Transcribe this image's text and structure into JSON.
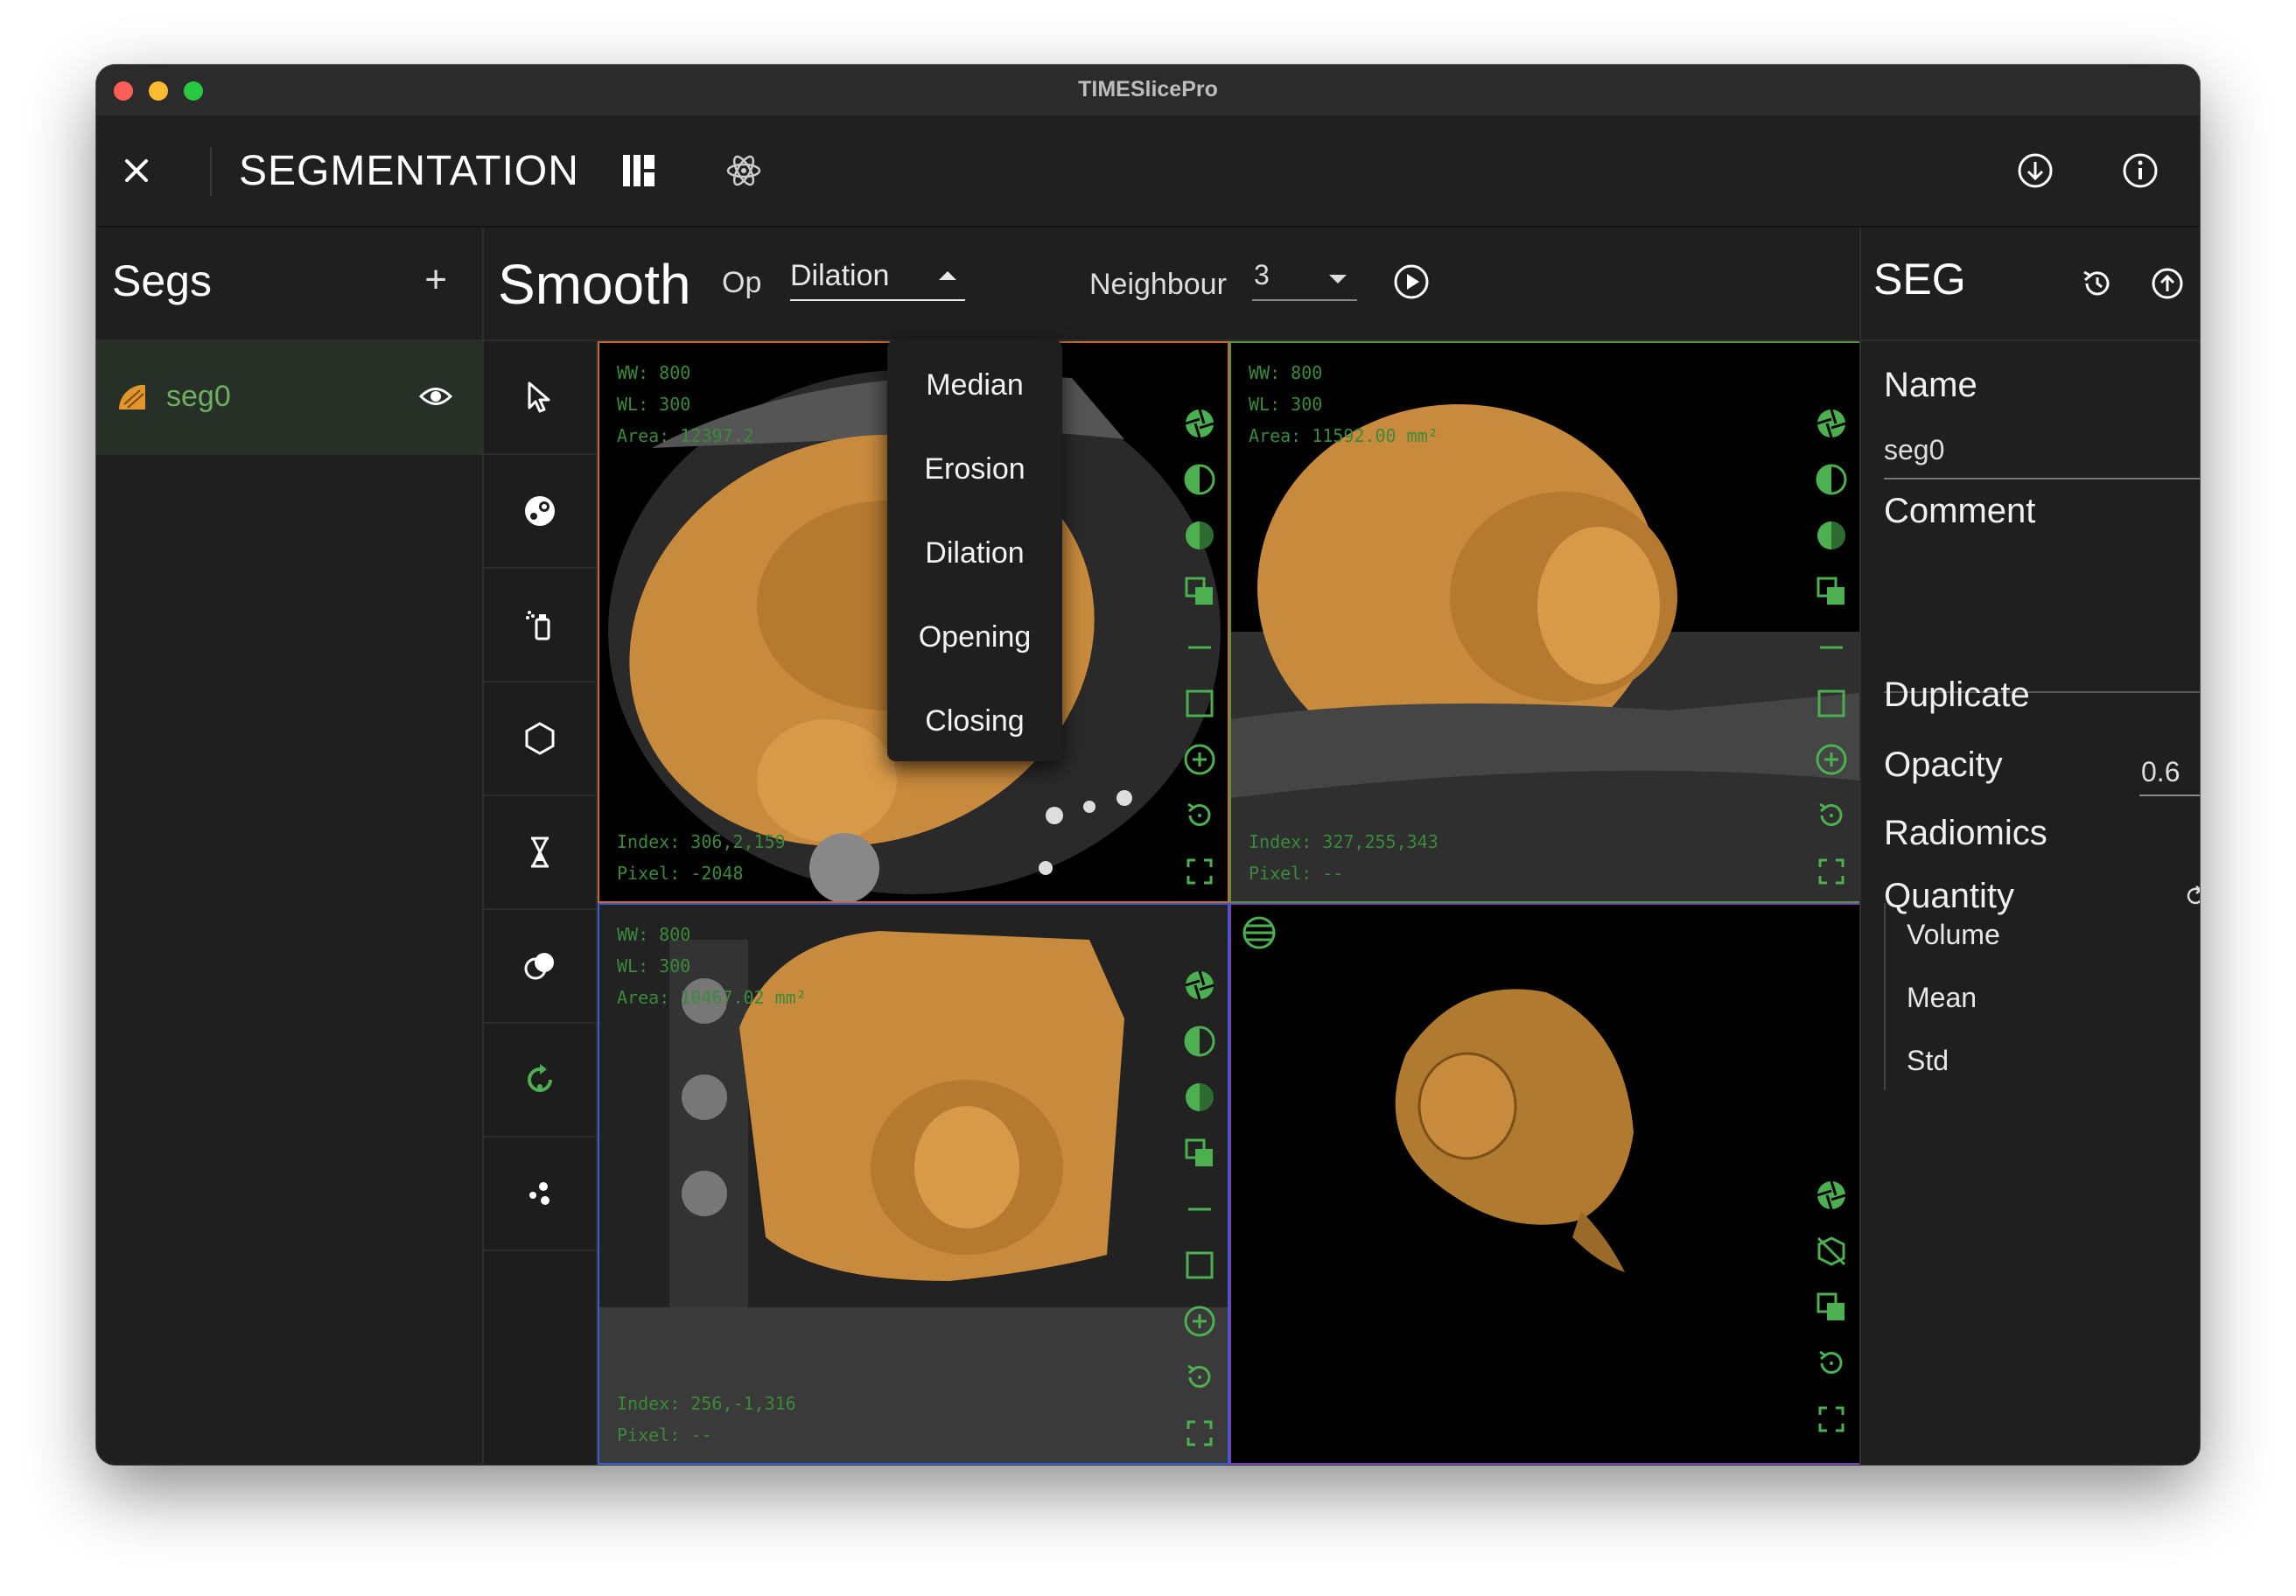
{
  "window": {
    "title": "TIMESlicePro"
  },
  "appbar": {
    "title": "SEGMENTATION"
  },
  "segs": {
    "title": "Segs",
    "add_label": "+",
    "items": [
      {
        "name": "seg0",
        "color": "#e0962c"
      }
    ]
  },
  "smooth": {
    "title": "Smooth",
    "op_label": "Op",
    "op_value": "Dilation",
    "neighbour_label": "Neighbour",
    "neighbour_value": "3",
    "op_options": [
      "Median",
      "Erosion",
      "Dilation",
      "Opening",
      "Closing"
    ]
  },
  "viewports": [
    {
      "ww": "WW: 800",
      "wl": "WL: 300",
      "area": "Area: 12397.2",
      "index": "Index: 306,2,159",
      "pixel": "Pixel: -2048",
      "border": "#c8692a"
    },
    {
      "ww": "WW: 800",
      "wl": "WL: 300",
      "area": "Area: 11592.00 mm²",
      "index": "Index: 327,255,343",
      "pixel": "Pixel: --",
      "border": "#4b9a3b"
    },
    {
      "ww": "WW: 800",
      "wl": "WL: 300",
      "area": "Area: 10467.02 mm²",
      "index": "Index: 256,-1,316",
      "pixel": "Pixel: --",
      "border": "#3a5fd0"
    },
    {
      "border": "#7b3fbd"
    }
  ],
  "seg_panel": {
    "title": "SEG",
    "name_label": "Name",
    "name_value": "seg0",
    "comment_label": "Comment",
    "duplicate_label": "Duplicate",
    "opacity_label": "Opacity",
    "opacity_value": "0.6",
    "radiomics_label": "Radiomics",
    "quantity_label": "Quantity",
    "quantity_items": [
      "Volume",
      "Mean",
      "Std"
    ]
  },
  "colors": {
    "accent_green": "#4caf50",
    "seg_orange": "#e0962c",
    "danger_red": "#e53935"
  }
}
